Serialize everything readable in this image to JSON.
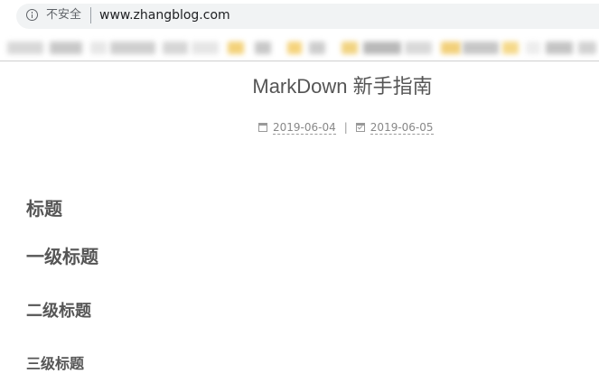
{
  "browser": {
    "security_label": "不安全",
    "url": "www.zhangblog.com"
  },
  "post": {
    "title": "MarkDown 新手指南",
    "created_date": "2019-06-04",
    "separator": "|",
    "updated_date": "2019-06-05"
  },
  "content": {
    "headings": [
      "标题",
      "一级标题",
      "二级标题",
      "三级标题"
    ]
  },
  "colors": {
    "omnibox_bg": "#f1f3f4",
    "text_gray": "#555555",
    "meta_gray": "#888888"
  }
}
